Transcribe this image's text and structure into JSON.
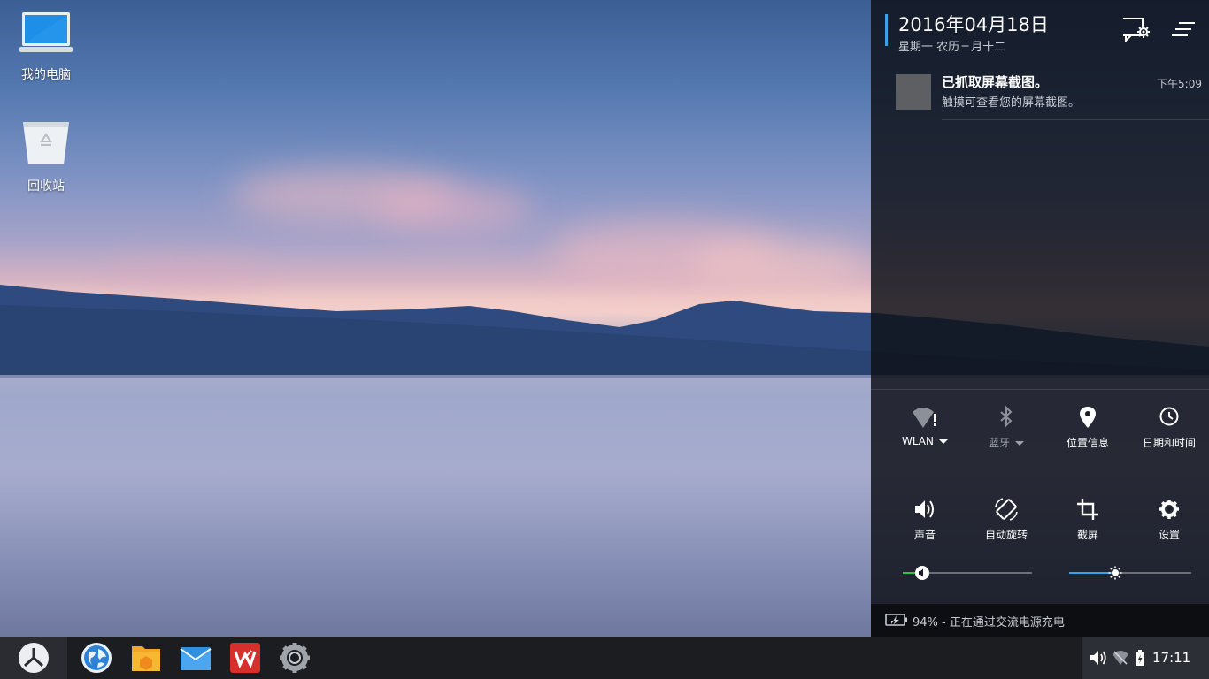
{
  "desktop": {
    "icons": [
      {
        "label": "我的电脑",
        "icon": "computer-icon"
      },
      {
        "label": "回收站",
        "icon": "recycle-bin-icon"
      }
    ]
  },
  "panel": {
    "date": "2016年04月18日",
    "lunar_date": "星期一 农历三月十二",
    "header_icons": [
      "notification-settings-icon",
      "clear-all-icon"
    ],
    "notification": {
      "title": "已抓取屏幕截图。",
      "body": "触摸可查看您的屏幕截图。",
      "time": "下午5:09"
    },
    "tiles": [
      {
        "label": "WLAN",
        "icon": "wifi-alert-icon",
        "dropdown": true
      },
      {
        "label": "蓝牙",
        "icon": "bluetooth-icon",
        "dropdown": true
      },
      {
        "label": "位置信息",
        "icon": "location-pin-icon"
      },
      {
        "label": "日期和时间",
        "icon": "clock-icon"
      },
      {
        "label": "声音",
        "icon": "speaker-icon"
      },
      {
        "label": "自动旋转",
        "icon": "auto-rotate-icon"
      },
      {
        "label": "截屏",
        "icon": "crop-icon"
      },
      {
        "label": "设置",
        "icon": "gear-icon"
      }
    ],
    "sliders": {
      "volume_level": 0.15,
      "brightness_level": 0.38
    },
    "battery": {
      "text": "94% - 正在通过交流电源充电",
      "icon": "battery-charging-icon"
    },
    "accent_color": "#3aa0e8",
    "volume_fill_color": "#35c24a"
  },
  "taskbar": {
    "apps": [
      "start-menu-icon",
      "browser-icon",
      "file-manager-icon",
      "mail-icon",
      "wps-office-icon",
      "settings-icon"
    ],
    "tray": {
      "icons": [
        "volume-icon",
        "wifi-off-icon",
        "battery-icon"
      ],
      "clock": "17:11"
    }
  }
}
